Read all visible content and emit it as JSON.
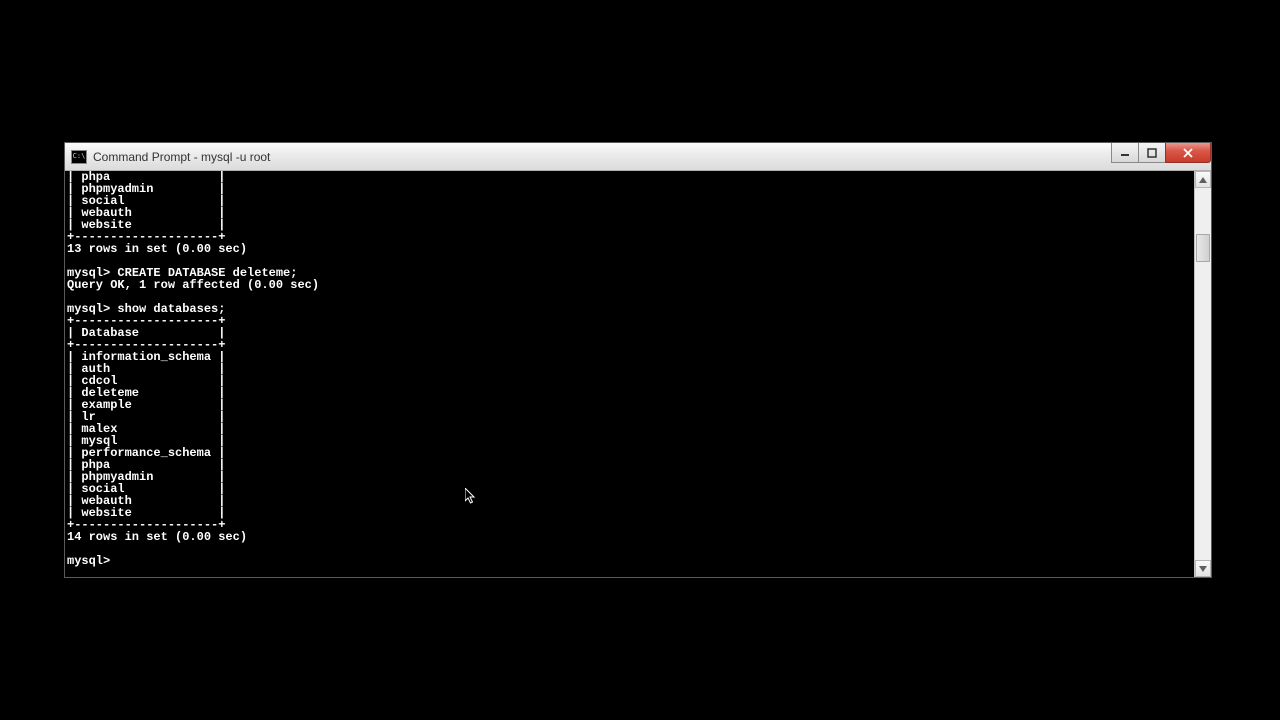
{
  "window": {
    "title": "Command Prompt - mysql  -u root",
    "icon_label": "C:\\"
  },
  "terminal": {
    "partial_top": [
      "| phpa               |",
      "| phpmyadmin         |",
      "| social             |",
      "| webauth            |",
      "| website            |",
      "+--------------------+"
    ],
    "prev_result": "13 rows in set (0.00 sec)",
    "blank1": "",
    "cmd1_prompt": "mysql> ",
    "cmd1": "CREATE DATABASE deleteme;",
    "cmd1_result": "Query OK, 1 row affected (0.00 sec)",
    "blank2": "",
    "cmd2_prompt": "mysql> ",
    "cmd2": "show databases;",
    "table_top": "+--------------------+",
    "table_header": "| Database           |",
    "table_sep": "+--------------------+",
    "rows": [
      "| information_schema |",
      "| auth               |",
      "| cdcol              |",
      "| deleteme           |",
      "| example            |",
      "| lr                 |",
      "| malex              |",
      "| mysql              |",
      "| performance_schema |",
      "| phpa               |",
      "| phpmyadmin         |",
      "| social             |",
      "| webauth            |",
      "| website            |"
    ],
    "table_bottom": "+--------------------+",
    "result2": "14 rows in set (0.00 sec)",
    "blank3": "",
    "prompt_final": "mysql> "
  }
}
